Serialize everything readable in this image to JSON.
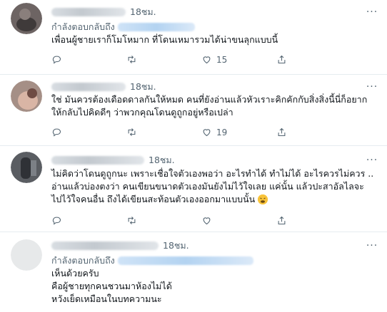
{
  "tweets": [
    {
      "time": "18ชม.",
      "reply_label": "กำลังตอบกลับถึง",
      "text": "เพื่อนผู้ชายเราก็โมโหมาก ที่โดนเหมารวมได้น่าขนลุกแบบนี้",
      "retweets": "",
      "likes": "15"
    },
    {
      "time": "18ชม.",
      "reply_label": "",
      "text": "ใช่ มันควรต้องเดือดดาลกันให้หมด คนที่ยังอ่านแล้วหัวเราะคิกคักกับสิ่งสิ่งนี้นี่ก็อยาก\nให้กลับไปคิดดีๆ ว่าพวกคุณโดนดูถูกอยู่หรือเปล่า",
      "retweets": "",
      "likes": "19"
    },
    {
      "time": "18ชม.",
      "reply_label": "",
      "text": "ไม่คิดว่าโดนดูถูกนะ เพราะเชื่อใจตัวเองพอว่า อะไรทำได้ ทำไม่ได้ อะไรควรไม่ควร ..\nอ่านแล้วบ่องตงว่า คนเขียนขนาดตัวเองมันยังไม่ไว้ใจเลย แค่นั้น แล้วปะสาอัลไลจะ\nไปไว้ใจคนอื่น ถึงได้เขียนสะท้อนตัวเองออกมาแบบนั้น",
      "retweets": "",
      "likes": ""
    },
    {
      "time": "18ชม.",
      "reply_label": "กำลังตอบกลับถึง",
      "text": "เห็นด้วยครับ\nคือผู้ชายทุกคนชวนมาห้องไม่ได้\nหวังเย็ดเหมือนในบทความนะ"
    }
  ],
  "icons": {
    "reply": "reply-icon",
    "retweet": "retweet-icon",
    "like": "heart-icon",
    "share": "share-icon",
    "more": "more-icon"
  },
  "more_glyph": "···",
  "accent_color": "#1d9bf0"
}
